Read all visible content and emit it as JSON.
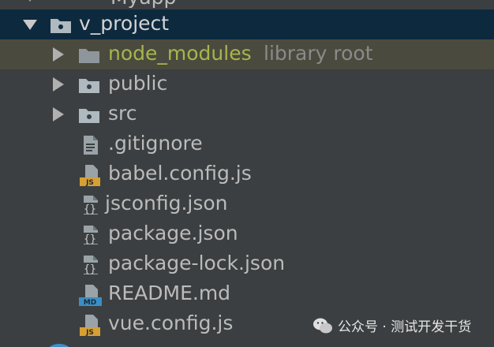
{
  "tree": {
    "top_partial_label": "Myapp",
    "project": {
      "name": "v_project"
    },
    "folders": [
      {
        "name": "node_modules",
        "hint": "library root"
      },
      {
        "name": "public"
      },
      {
        "name": "src"
      }
    ],
    "files": [
      {
        "name": ".gitignore",
        "icon": "text-file-icon"
      },
      {
        "name": "babel.config.js",
        "icon": "js-file-icon",
        "badge": "JS"
      },
      {
        "name": "jsconfig.json",
        "icon": "json-file-icon"
      },
      {
        "name": "package.json",
        "icon": "json-file-icon"
      },
      {
        "name": "package-lock.json",
        "icon": "json-file-icon"
      },
      {
        "name": "README.md",
        "icon": "md-file-icon",
        "badge": "MD"
      },
      {
        "name": "vue.config.js",
        "icon": "js-file-icon",
        "badge": "JS"
      }
    ]
  },
  "watermark": {
    "text": "公众号 · 测试开发干货"
  },
  "colors": {
    "background": "#3c3f41",
    "selected_row": "#0d293e",
    "hover_row": "#4b4a3e",
    "excluded_folder_text": "#a8b54c",
    "js_badge": "#d6a034",
    "md_badge": "#3b8fc4"
  }
}
